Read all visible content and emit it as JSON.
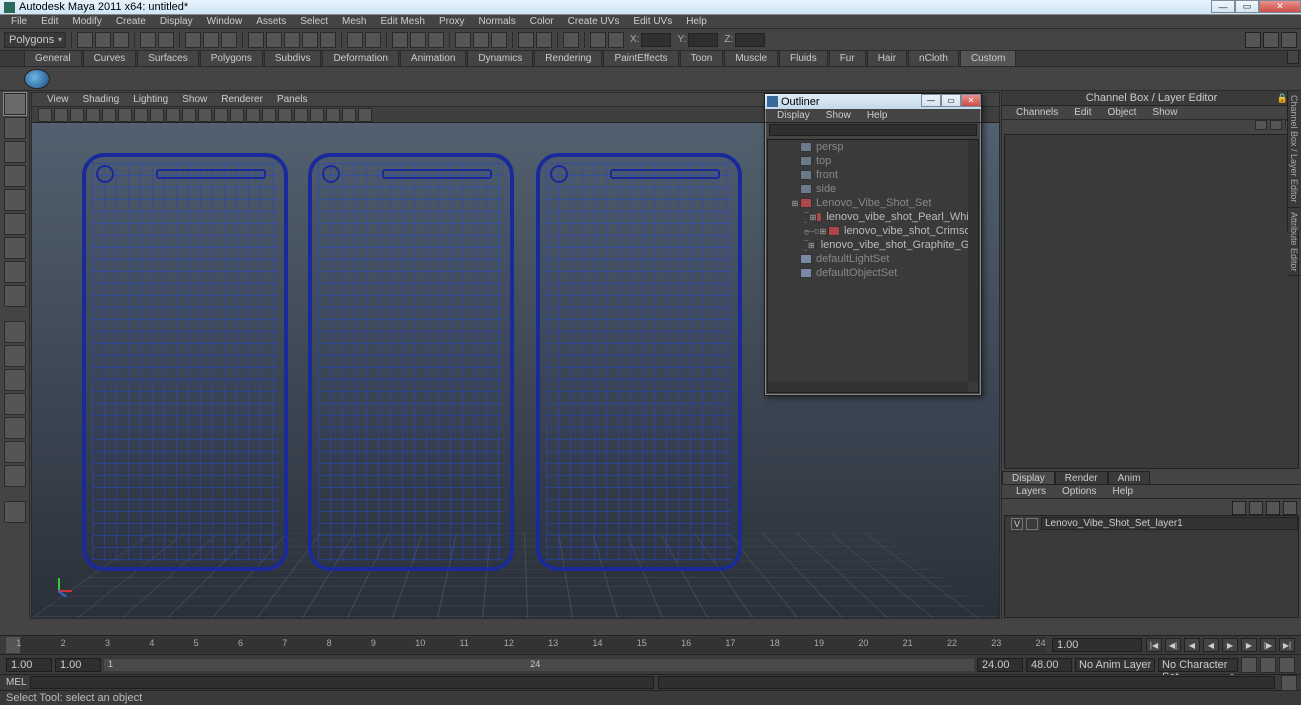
{
  "title": "Autodesk Maya 2011 x64: untitled*",
  "mainmenu": [
    "File",
    "Edit",
    "Modify",
    "Create",
    "Display",
    "Window",
    "Assets",
    "Select",
    "Mesh",
    "Edit Mesh",
    "Proxy",
    "Normals",
    "Color",
    "Create UVs",
    "Edit UVs",
    "Help"
  ],
  "selection_mode": "Polygons",
  "coord_labels": {
    "x": "X:",
    "y": "Y:",
    "z": "Z:"
  },
  "shelves": [
    "General",
    "Curves",
    "Surfaces",
    "Polygons",
    "Subdivs",
    "Deformation",
    "Animation",
    "Dynamics",
    "Rendering",
    "PaintEffects",
    "Toon",
    "Muscle",
    "Fluids",
    "Fur",
    "Hair",
    "nCloth",
    "Custom"
  ],
  "active_shelf": "Custom",
  "panel_menu": [
    "View",
    "Shading",
    "Lighting",
    "Show",
    "Renderer",
    "Panels"
  ],
  "outliner": {
    "title": "Outliner",
    "menu": [
      "Display",
      "Show",
      "Help"
    ],
    "items": [
      {
        "type": "cam",
        "label": "persp",
        "depth": 1
      },
      {
        "type": "cam",
        "label": "top",
        "depth": 1
      },
      {
        "type": "cam",
        "label": "front",
        "depth": 1
      },
      {
        "type": "cam",
        "label": "side",
        "depth": 1
      },
      {
        "type": "mesh",
        "label": "Lenovo_Vibe_Shot_Set",
        "depth": 1,
        "exp": "+",
        "icon": "mesh"
      },
      {
        "type": "mesh",
        "label": "lenovo_vibe_shot_Pearl_White",
        "depth": 2,
        "exp": "+",
        "icon": "mesh",
        "link": true
      },
      {
        "type": "mesh",
        "label": "lenovo_vibe_shot_Crimson",
        "depth": 2,
        "exp": "+",
        "icon": "mesh",
        "link": true
      },
      {
        "type": "mesh",
        "label": "lenovo_vibe_shot_Graphite_Grey",
        "depth": 2,
        "exp": "+",
        "icon": "mesh",
        "link": true
      },
      {
        "type": "set",
        "label": "defaultLightSet",
        "depth": 1,
        "icon": "set"
      },
      {
        "type": "set",
        "label": "defaultObjectSet",
        "depth": 1,
        "icon": "set"
      }
    ]
  },
  "channelbox": {
    "title": "Channel Box / Layer Editor",
    "menu": [
      "Channels",
      "Edit",
      "Object",
      "Show"
    ]
  },
  "layers": {
    "tabs": [
      "Display",
      "Render",
      "Anim"
    ],
    "active": "Display",
    "menu": [
      "Layers",
      "Options",
      "Help"
    ],
    "rows": [
      {
        "vis": "V",
        "name": "Lenovo_Vibe_Shot_Set_layer1"
      }
    ]
  },
  "timeslider": {
    "ticks": [
      "1",
      "2",
      "3",
      "4",
      "5",
      "6",
      "7",
      "8",
      "9",
      "10",
      "11",
      "12",
      "13",
      "14",
      "15",
      "16",
      "17",
      "18",
      "19",
      "20",
      "21",
      "22",
      "23",
      "24"
    ],
    "current": "1.00"
  },
  "range": {
    "start_all": "1.00",
    "start": "1.00",
    "end": "24.00",
    "end_all": "48.00",
    "bar_start": "1",
    "bar_end": "24",
    "anim_layer": "No Anim Layer",
    "char_set": "No Character Set"
  },
  "cmd": {
    "lang": "MEL"
  },
  "helpline": "Select Tool: select an object",
  "side_tabs": [
    "Channel Box / Layer Editor",
    "Attribute Editor"
  ]
}
